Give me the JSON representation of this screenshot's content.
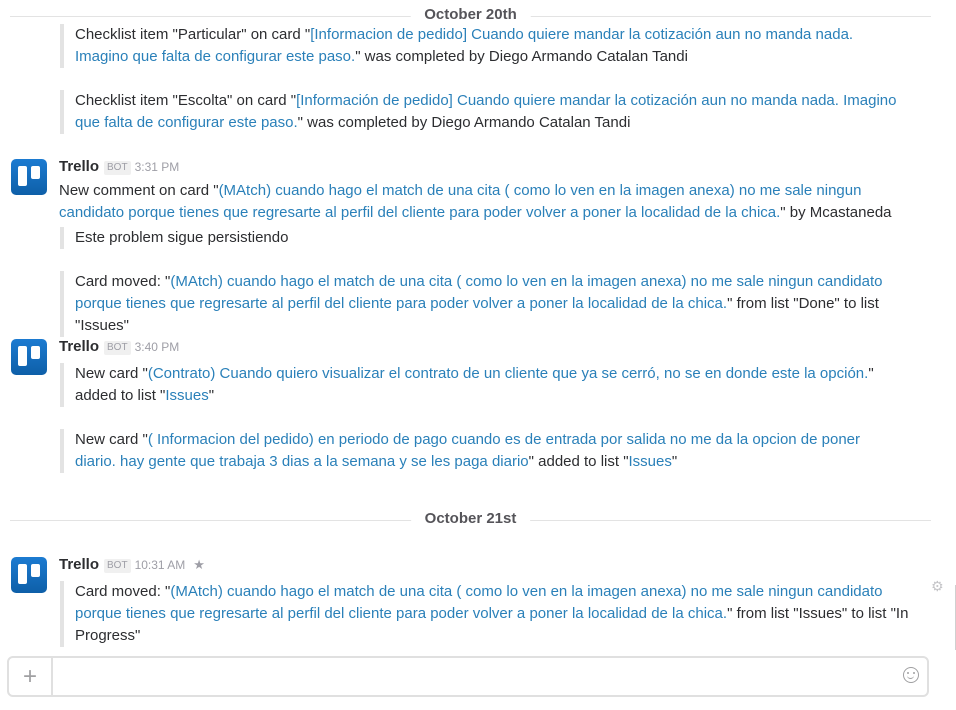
{
  "dividers": {
    "day1": "October 20th",
    "day2": "October 21st"
  },
  "m0": {
    "att1": {
      "p1": "Checklist item \"Particular\" on card \"",
      "link": "[Informacion de pedido] Cuando quiere mandar la cotización aun no manda nada. Imagino que falta de configurar este paso.",
      "p2": "\" was completed by Diego Armando Catalan Tandi"
    },
    "att2": {
      "p1": "Checklist item \"Escolta\" on card \"",
      "link": "[Información de pedido] Cuando quiere mandar la cotización aun no manda nada. Imagino que falta de configurar este paso.",
      "p2": "\" was completed by Diego Armando Catalan Tandi"
    }
  },
  "m1": {
    "sender": "Trello",
    "bot": "BOT",
    "time": "3:31 PM",
    "text_p1": "New comment on card \"",
    "text_link": "(MAtch) cuando hago el match de una cita ( como lo ven en la imagen anexa) no me sale ningun candidato porque tienes que regresarte al perfil del cliente para poder volver a poner la localidad de la chica.",
    "text_p2": "\" by Mcastaneda",
    "att1": "Este problem sigue persistiendo",
    "att2": {
      "p1": "Card moved: \"",
      "link": "(MAtch) cuando hago el match de una cita ( como lo ven en la imagen anexa) no me sale ningun candidato porque tienes que regresarte al perfil del cliente para poder volver a poner la localidad de la chica.",
      "p2": "\" from list \"Done\" to list \"Issues\""
    }
  },
  "m2": {
    "sender": "Trello",
    "bot": "BOT",
    "time": "3:40 PM",
    "att1": {
      "p1": "New card \"",
      "link": "(Contrato) Cuando quiero visualizar el contrato de un cliente que ya se cerró, no se en donde este la opción.",
      "p2": "\" added to list \"",
      "list": "Issues",
      "p3": "\""
    },
    "att2": {
      "p1": "New card \"",
      "link": "( Informacion del pedido) en periodo de pago cuando es de entrada por salida no me da la opcion de poner diario. hay gente que trabaja 3 dias a la semana y se les paga diario",
      "p2": "\" added to list \"",
      "list": "Issues",
      "p3": "\""
    }
  },
  "m3": {
    "sender": "Trello",
    "bot": "BOT",
    "time": "10:31 AM",
    "star": "★",
    "att1": {
      "p1": "Card moved: \"",
      "link": "(MAtch) cuando hago el match de una cita ( como lo ven en la imagen anexa) no me sale ningun candidato porque tienes que regresarte al perfil del cliente para poder volver a poner la localidad de la chica.",
      "p2": "\" from list \"Issues\" to list \"In Progress\""
    }
  },
  "footer": {
    "plus": "+",
    "input_value": "",
    "gear": "⚙"
  },
  "icons": {
    "avatar": "trello-logo-icon",
    "emoji": "smiley-icon",
    "add": "plus-icon",
    "star": "star-icon",
    "settings": "gear-icon"
  },
  "colors": {
    "link": "#2a80b9",
    "brand": "#0e74cc"
  }
}
